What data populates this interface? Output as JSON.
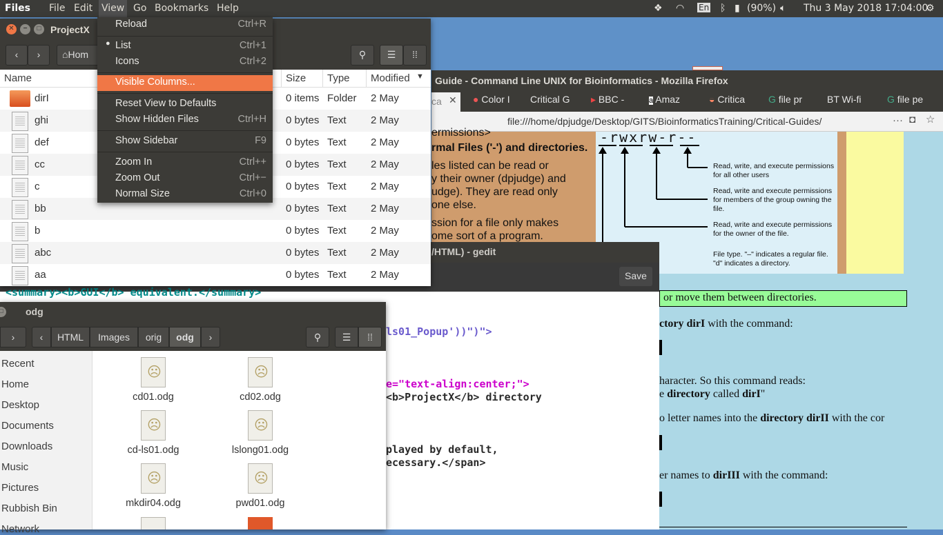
{
  "topbar": {
    "app": "Files",
    "menus": [
      "File",
      "Edit",
      "View",
      "Go",
      "Bookmarks",
      "Help"
    ],
    "lang": "En",
    "battery": "(90%)",
    "datetime": "Thu  3 May 2018 17:04:00"
  },
  "firefox": {
    "title": "Guide - Command Line UNIX for Bioinformatics - Mozilla Firefox",
    "tabs": [
      "ca",
      "Color I",
      "Critical G",
      "BBC -",
      "Amaz",
      "Critica",
      "file pr",
      "BT Wi-fi",
      "file pe"
    ],
    "url": "file:///home/dpjudge/Desktop/GITS/BioinformaticsTraining/Critical-Guides/",
    "perm_string": "-rwxrw-r--",
    "perm_notes": [
      "Read, write, and execute permissions for all other users",
      "Read, write and execute permissions for members of the group owning the file.",
      "Read, write and execute permissions for the owner of the file.",
      "File type.  \"–\" indicates a regular file.  \"d\" indicates a directory."
    ],
    "left_text": [
      "ermissions>",
      "rmal Files ('-') and directories.",
      "les listed can be read or",
      "y their owner (dpjudge) and",
      "udge). They are read only",
      "one else.",
      "ssion for a file only makes",
      "ome sort of a program."
    ],
    "lines": [
      "or move them between directories.",
      "ctory dirI with the command:",
      "haracter. So this command reads:",
      "e directory called dirI\"",
      "o letter names into the directory dirII with the cor",
      "er names to dirIII with the command:"
    ]
  },
  "gedit": {
    "title": "/HTML) - gedit",
    "save": "Save",
    "code_lines": [
      "<summary><b>GUI</b> equivalent.</summary>",
      "ls01_Popup'))\")\">",
      "e=\"text-align:center;\">",
      "<b>ProjectX</b> directory",
      "played by default,",
      "ecessary.</span>"
    ]
  },
  "files": {
    "title": "ProjectX",
    "home": "Hom",
    "cols": {
      "name": "Name",
      "size": "Size",
      "type": "Type",
      "modified": "Modified"
    },
    "rows": [
      {
        "name": "dirI",
        "size": "0 items",
        "type": "Folder",
        "mod": "2 May"
      },
      {
        "name": "ghi",
        "size": "0 bytes",
        "type": "Text",
        "mod": "2 May"
      },
      {
        "name": "def",
        "size": "0 bytes",
        "type": "Text",
        "mod": "2 May"
      },
      {
        "name": "cc",
        "size": "0 bytes",
        "type": "Text",
        "mod": "2 May"
      },
      {
        "name": "c",
        "size": "0 bytes",
        "type": "Text",
        "mod": "2 May"
      },
      {
        "name": "bb",
        "size": "0 bytes",
        "type": "Text",
        "mod": "2 May"
      },
      {
        "name": "b",
        "size": "0 bytes",
        "type": "Text",
        "mod": "2 May"
      },
      {
        "name": "abc",
        "size": "0 bytes",
        "type": "Text",
        "mod": "2 May"
      },
      {
        "name": "aa",
        "size": "0 bytes",
        "type": "Text",
        "mod": "2 May"
      }
    ]
  },
  "menu": {
    "reload": {
      "label": "Reload",
      "accel": "Ctrl+R"
    },
    "list": {
      "label": "List",
      "accel": "Ctrl+1"
    },
    "icons": {
      "label": "Icons",
      "accel": "Ctrl+2"
    },
    "visible_columns": {
      "label": "Visible Columns..."
    },
    "reset": {
      "label": "Reset View to Defaults"
    },
    "hidden": {
      "label": "Show Hidden Files",
      "accel": "Ctrl+H"
    },
    "sidebar": {
      "label": "Show Sidebar",
      "accel": "F9"
    },
    "zoom_in": {
      "label": "Zoom In",
      "accel": "Ctrl++"
    },
    "zoom_out": {
      "label": "Zoom Out",
      "accel": "Ctrl+−"
    },
    "normal": {
      "label": "Normal Size",
      "accel": "Ctrl+0"
    }
  },
  "odg": {
    "title": "odg",
    "path": [
      "HTML",
      "Images",
      "orig",
      "odg"
    ],
    "sidebar": [
      "Recent",
      "Home",
      "Desktop",
      "Documents",
      "Downloads",
      "Music",
      "Pictures",
      "Rubbish Bin",
      "Network"
    ],
    "files": [
      "cd01.odg",
      "cd02.odg",
      "cd-ls01.odg",
      "lslong01.odg",
      "mkdir04.odg",
      "pwd01.odg"
    ]
  }
}
